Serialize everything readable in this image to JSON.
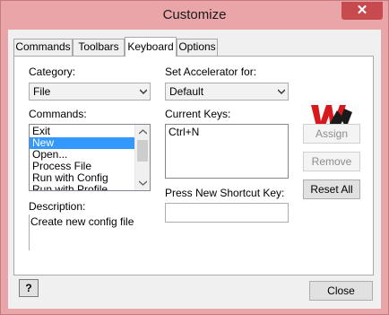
{
  "window": {
    "title": "Customize",
    "close_glyph": "✕"
  },
  "tabs": [
    {
      "label": "Commands",
      "active": false
    },
    {
      "label": "Toolbars",
      "active": false
    },
    {
      "label": "Keyboard",
      "active": true
    },
    {
      "label": "Options",
      "active": false
    }
  ],
  "keyboard": {
    "category_label": "Category:",
    "category_value": "File",
    "commands_label": "Commands:",
    "commands": [
      "Exit",
      "New",
      "Open...",
      "Process File",
      "Run with Config",
      "Run with Profile"
    ],
    "selected_command": "New",
    "description_label": "Description:",
    "description": "Create new config file",
    "accelerator_label": "Set Accelerator for:",
    "accelerator_value": "Default",
    "current_keys_label": "Current Keys:",
    "current_keys": [
      "Ctrl+N"
    ],
    "shortcut_label": "Press New Shortcut Key:",
    "shortcut_value": "",
    "assign_label": "Assign",
    "remove_label": "Remove",
    "reset_all_label": "Reset All"
  },
  "footer": {
    "close_label": "Close",
    "help_glyph": "?"
  },
  "colors": {
    "title_bar": "#eaa5a8",
    "close_button": "#c74a4f",
    "selection": "#3399ff",
    "logo_red": "#d7191f"
  },
  "icons": [
    "close-icon",
    "chevron-down-icon",
    "help-icon",
    "wm-logo-icon"
  ]
}
